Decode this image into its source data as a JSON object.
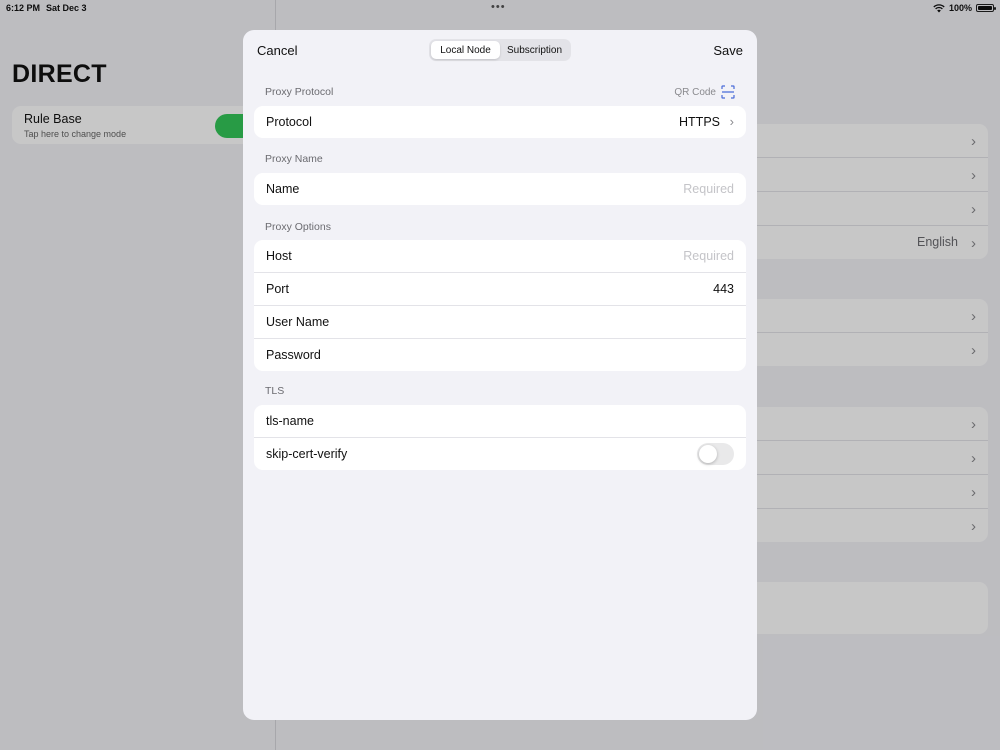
{
  "status": {
    "time": "6:12 PM",
    "date": "Sat Dec 3",
    "battery": "100%"
  },
  "background": {
    "sidebar_title": "DIRECT",
    "mode": {
      "label": "Rule Base",
      "sub": "Tap here to change mode"
    },
    "language_value": "English"
  },
  "modal": {
    "cancel": "Cancel",
    "save": "Save",
    "tabs": [
      "Local Node",
      "Subscription"
    ],
    "qr_label": "QR Code",
    "sections": {
      "protocol": "Proxy Protocol",
      "name": "Proxy Name",
      "options": "Proxy Options",
      "tls": "TLS"
    },
    "protocol_row": {
      "label": "Protocol",
      "value": "HTTPS"
    },
    "name_row": {
      "label": "Name",
      "placeholder": "Required"
    },
    "host_row": {
      "label": "Host",
      "placeholder": "Required"
    },
    "port_row": {
      "label": "Port",
      "value": "443"
    },
    "username_row": {
      "label": "User Name"
    },
    "password_row": {
      "label": "Password"
    },
    "tls_name_row": {
      "label": "tls-name"
    },
    "skip_cert_row": {
      "label": "skip-cert-verify",
      "enabled": false
    }
  },
  "icons": [
    "qr-scan-icon",
    "chevron-right-icon",
    "wifi-icon",
    "battery-icon"
  ]
}
